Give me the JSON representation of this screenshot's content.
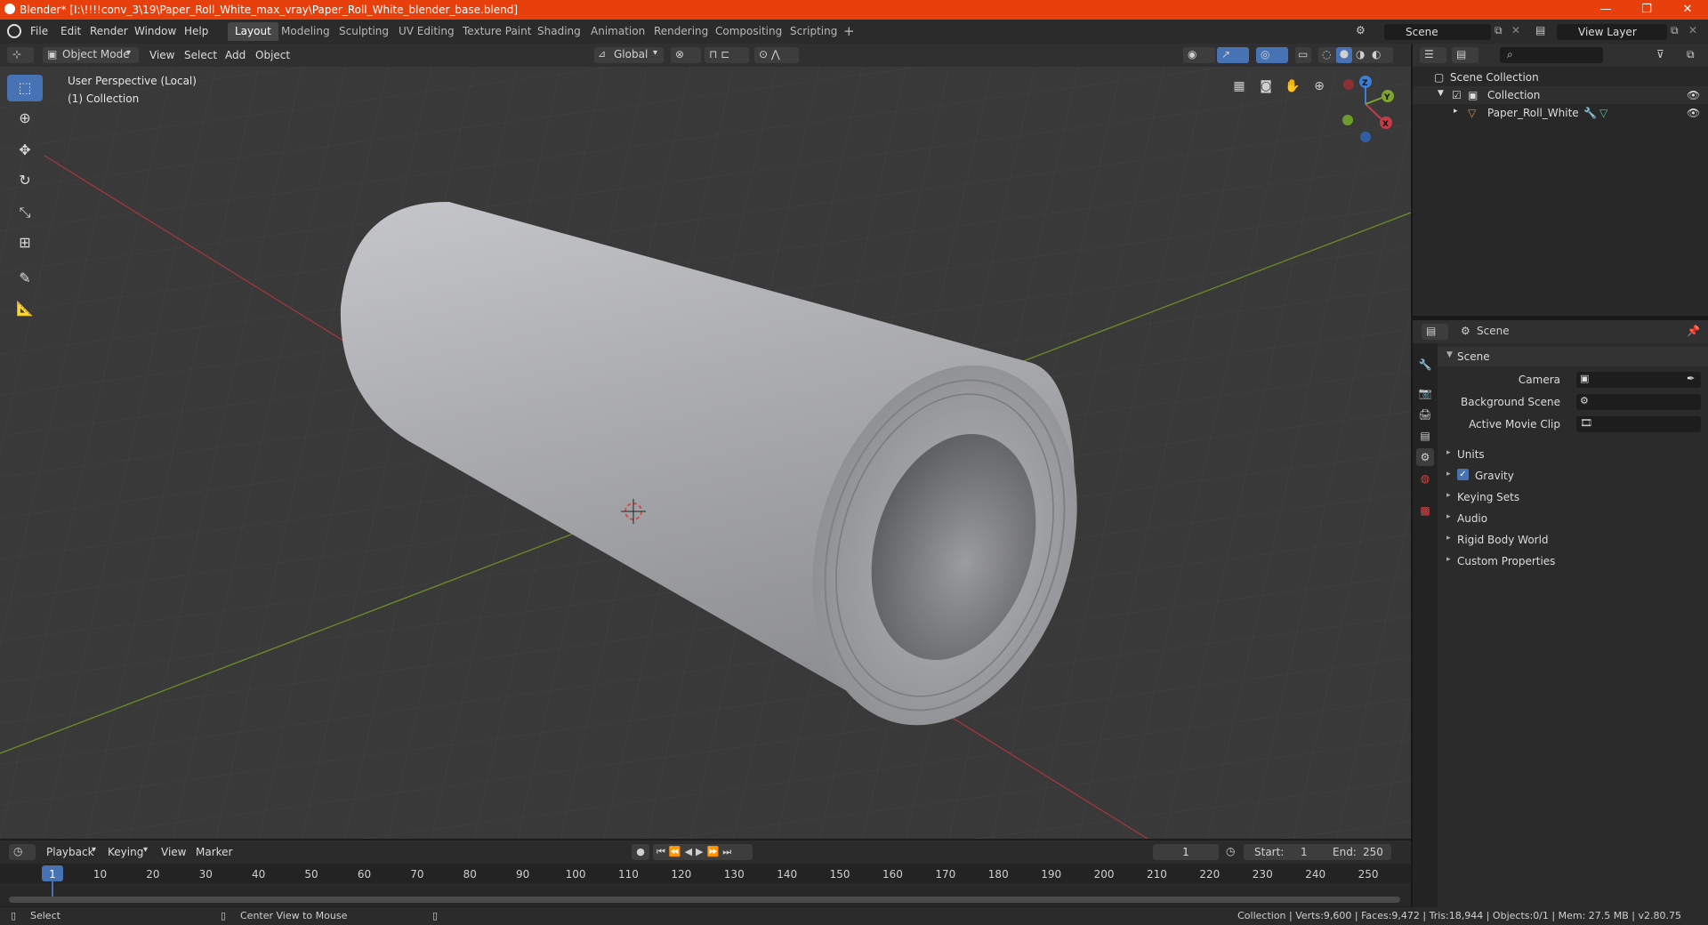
{
  "window": {
    "title": "Blender* [I:\\!!!!conv_3\\19\\Paper_Roll_White_max_vray\\Paper_Roll_White_blender_base.blend]",
    "minimize": "—",
    "maximize": "❐",
    "close": "✕"
  },
  "menubar": {
    "items": [
      "File",
      "Edit",
      "Render",
      "Window",
      "Help"
    ],
    "workspace_tabs": [
      "Layout",
      "Modeling",
      "Sculpting",
      "UV Editing",
      "Texture Paint",
      "Shading",
      "Animation",
      "Rendering",
      "Compositing",
      "Scripting"
    ],
    "add_tab": "+",
    "scene": "Scene",
    "view_layer": "View Layer"
  },
  "viewport_header": {
    "mode": "Object Mode",
    "menus": [
      "View",
      "Select",
      "Add",
      "Object"
    ],
    "transform_orientation": "Global"
  },
  "viewport": {
    "perspective_label": "User Perspective (Local)",
    "collection_label": "(1) Collection",
    "gizmo": {
      "x": "X",
      "y": "Y",
      "z": "Z"
    }
  },
  "outliner": {
    "root": "Scene Collection",
    "collection": "Collection",
    "object": "Paper_Roll_White"
  },
  "properties": {
    "header": "Scene",
    "section": "Scene",
    "fields": [
      {
        "label": "Camera"
      },
      {
        "label": "Background Scene"
      },
      {
        "label": "Active Movie Clip"
      }
    ],
    "panels": [
      "Units",
      "Gravity",
      "Keying Sets",
      "Audio",
      "Rigid Body World",
      "Custom Properties"
    ],
    "gravity_checked": true
  },
  "timeline": {
    "menus": [
      "Playback",
      "Keying",
      "View",
      "Marker"
    ],
    "current_frame": "1",
    "start_label": "Start:",
    "start": "1",
    "end_label": "End:",
    "end": "250",
    "ticks": [
      "1",
      "10",
      "20",
      "30",
      "40",
      "50",
      "60",
      "70",
      "80",
      "90",
      "100",
      "110",
      "120",
      "130",
      "140",
      "150",
      "160",
      "170",
      "180",
      "190",
      "200",
      "210",
      "220",
      "230",
      "240",
      "250"
    ]
  },
  "statusbar": {
    "left": "Select",
    "middle": "Center View to Mouse",
    "right": "Collection | Verts:9,600 | Faces:9,472 | Tris:18,944 | Objects:0/1 | Mem: 27.5 MB | v2.80.75"
  },
  "colors": {
    "titlebar": "#e8400c",
    "accent": "#4772b3",
    "x_axis": "#c43c4a",
    "y_axis": "#7fa52e",
    "z_axis": "#3c7fd6"
  }
}
